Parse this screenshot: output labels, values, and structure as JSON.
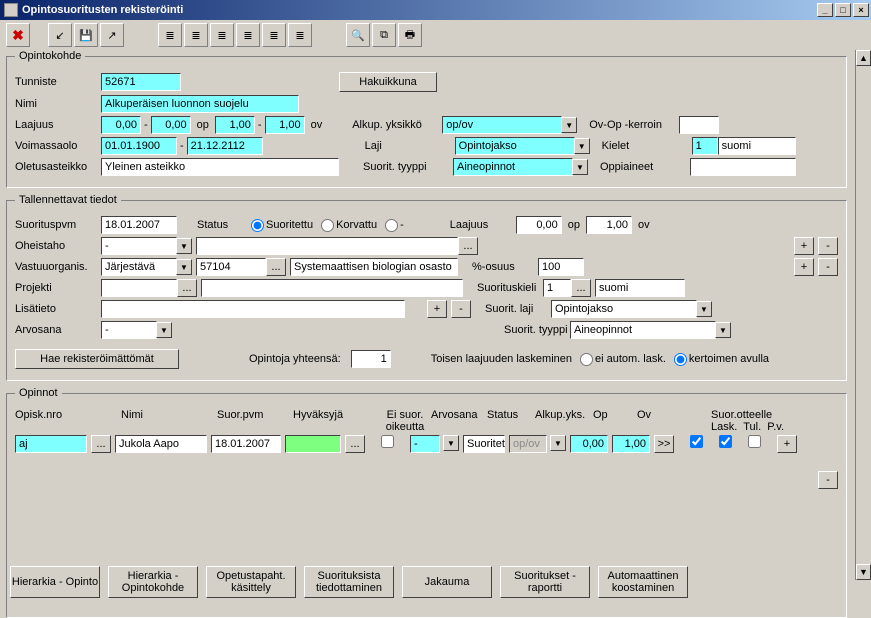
{
  "window": {
    "title": "Opintosuoritusten rekisteröinti"
  },
  "opintokohde": {
    "legend": "Opintokohde",
    "labels": {
      "tunniste": "Tunniste",
      "nimi": "Nimi",
      "laajuus": "Laajuus",
      "voimassaolo": "Voimassaolo",
      "oletusasteikko": "Oletusasteikko",
      "alkupyksikko": "Alkup. yksikkö",
      "laji": "Laji",
      "suorittyyppi": "Suorit. tyyppi",
      "ovopkerroin": "Ov-Op -kerroin",
      "kielet": "Kielet",
      "oppiaineet": "Oppiaineet",
      "op": "op",
      "ov": "ov"
    },
    "tunniste": "52671",
    "nimi": "Alkuperäisen luonnon suojelu",
    "laajuus1a": "0,00",
    "laajuus1b": "0,00",
    "laajuus2a": "1,00",
    "laajuus2b": "1,00",
    "voim_from": "01.01.1900",
    "voim_to": "21.12.2112",
    "oletusasteikko": "Yleinen asteikko",
    "alkupyksikko": "op/ov",
    "laji": "Opintojakso",
    "suorittyyppi": "Aineopinnot",
    "kieli_nro": "1",
    "kieli_name": "suomi",
    "hakubtn": "Hakuikkuna"
  },
  "tallennettavat": {
    "legend": "Tallennettavat tiedot",
    "labels": {
      "suorituspvm": "Suorituspvm",
      "oheistaho": "Oheistaho",
      "vastuuorg": "Vastuuorganis.",
      "projekti": "Projekti",
      "lisatieto": "Lisätieto",
      "arvosana": "Arvosana",
      "status": "Status",
      "suoritettu": "Suoritettu",
      "korvattu": "Korvattu",
      "laajuus": "Laajuus",
      "op": "op",
      "ov": "ov",
      "posuus": "%-osuus",
      "suorituskieli": "Suorituskieli",
      "suoritlaji": "Suorit. laji",
      "suorittyyppi": "Suorit. tyyppi"
    },
    "suorituspvm": "18.01.2007",
    "oheistaho": "-",
    "vastuuorg": "Järjestävä",
    "vastuuorg_code": "57104",
    "vastuuorg_name": "Systemaattisen biologian osasto",
    "arvosana": "-",
    "laajuus_op": "0,00",
    "laajuus_ov": "1,00",
    "posuus": "100",
    "kieli_nro": "1",
    "kieli_name": "suomi",
    "suoritlaji": "Opintojakso",
    "suorittyyppi": "Aineopinnot",
    "hae_btn": "Hae rekisteröimättömät",
    "opintoja_lbl": "Opintoja yhteensä:",
    "opintoja_val": "1",
    "toisen_lbl": "Toisen laajuuden laskeminen",
    "eiautom": "ei autom. lask.",
    "kertoim": "kertoimen avulla"
  },
  "opinnot": {
    "legend": "Opinnot",
    "cols": {
      "opisk": "Opisk.nro",
      "nimi": "Nimi",
      "suorpvm": "Suor.pvm",
      "hyvaksyja": "Hyväksyjä",
      "eisuor1": "Ei suor.",
      "eisuor2": "oikeutta",
      "arvosana": "Arvosana",
      "status": "Status",
      "alkup": "Alkup.yks.",
      "op": "Op",
      "ov": "Ov",
      "suorotteelle": "Suor.otteelle",
      "lask": "Lask.",
      "tul": "Tul.",
      "pv": "P.v."
    },
    "row": {
      "opisk": "aj",
      "nimi": "Jukola Aapo",
      "suorpvm": "18.01.2007",
      "hyvaksyja": "",
      "arvosana": "-",
      "status": "Suoritet",
      "alkup": "op/ov",
      "op": "0,00",
      "ov": "1,00"
    }
  },
  "buttons": {
    "hierarkia_opinto": "Hierarkia - Opinto",
    "hierarkia_ok": "Hierarkia - Opintokohde",
    "opetustapaht": "Opetustapaht. käsittely",
    "suorituksista": "Suorituksista tiedottaminen",
    "jakauma": "Jakauma",
    "suoritukset": "Suoritukset -raportti",
    "automaattinen": "Automaattinen koostaminen",
    "plus": "+",
    "minus": "-",
    "dots": "...",
    "more": ">>"
  }
}
